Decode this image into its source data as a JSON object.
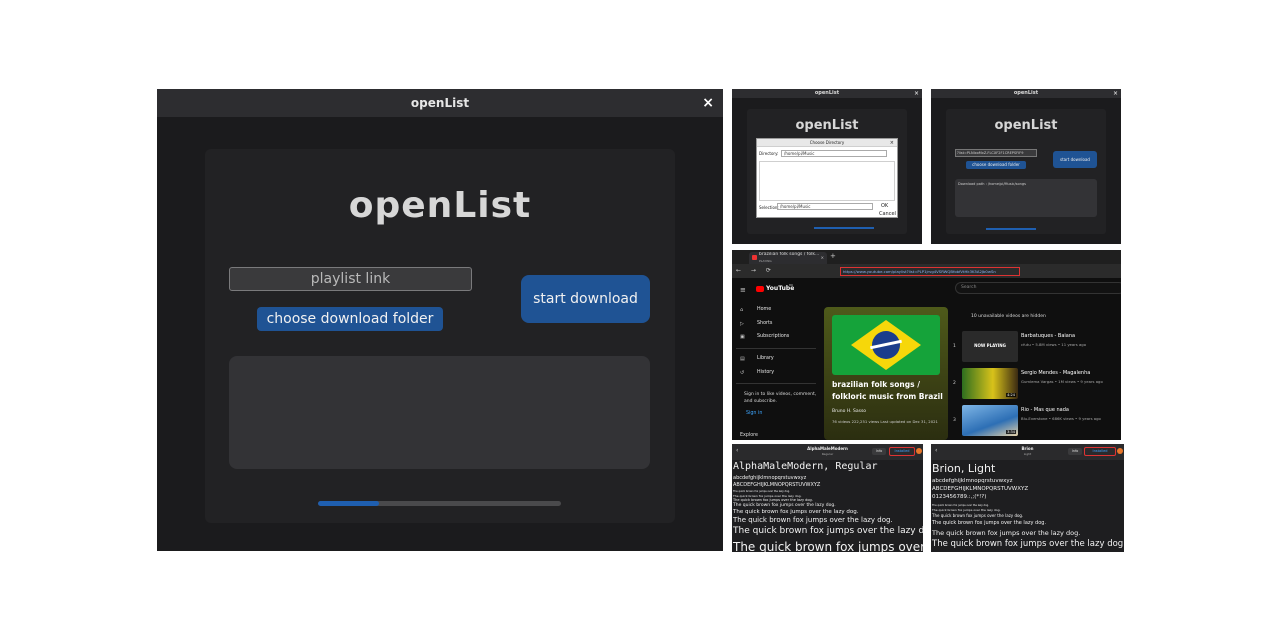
{
  "main": {
    "title": "openList",
    "close_glyph": "×",
    "logo_text": "openList",
    "playlist_placeholder": "playlist link",
    "choose_folder_label": "choose download folder",
    "start_download_label": "start download",
    "progress_fraction": 0.25
  },
  "thumb_dialog": {
    "window_title": "openList",
    "close_glyph": "×",
    "logo_text": "openList",
    "dialog_title": "Choose Directory",
    "dialog_close": "×",
    "directory_label": "Directory:",
    "directory_value": "/home/pi/Music",
    "selection_label": "Selection:",
    "selection_value": "/home/pi/Music",
    "ok_label": "OK",
    "cancel_label": "Cancel"
  },
  "thumb_running": {
    "window_title": "openList",
    "close_glyph": "×",
    "logo_text": "openList",
    "url_value": "?list=PLNIxoMxZ-FLCXF2F1CREPSFIF9",
    "choose_folder_label": "choose download folder",
    "start_download_label": "start download",
    "log_text": "Download path : /home/pi/Music/songs"
  },
  "youtube": {
    "tab_title": "brazilian folk songs / folk...",
    "tab_subtitle": "PLAYING",
    "tab_close": "×",
    "new_tab": "+",
    "nav_icons": "← → ⟳",
    "url": "https://www.youtube.com/playlist?list=PLP1jrvg4VSRWQBfobfVtHk3K5A2Jb0wSn",
    "menu_icon": "≡",
    "logo": "YouTube",
    "logo_sup": "BR",
    "search_placeholder": "Search",
    "sidebar": [
      {
        "icon": "⌂",
        "label": "Home"
      },
      {
        "icon": "▷",
        "label": "Shorts"
      },
      {
        "icon": "▣",
        "label": "Subscriptions"
      },
      {
        "icon": "▤",
        "label": "Library"
      },
      {
        "icon": "↺",
        "label": "History"
      }
    ],
    "signin_text": "Sign in to like videos, comment, and subscribe.",
    "signin_button": "Sign in",
    "explore": "Explore",
    "playlist_title": "brazilian folk songs / folkloric music from Brazil",
    "playlist_author": "Bruno H. Sasso",
    "playlist_meta": "76 videos  222,251 views  Last updated on Dec 31, 2021",
    "unavailable_note": "10 unavailable videos are hidden",
    "videos": [
      {
        "num": "1",
        "title": "Barbatuques - Baiana",
        "meta": "cfutu • 5.8M views • 11 years ago",
        "badge": "NOW PLAYING"
      },
      {
        "num": "2",
        "title": "Sergio Mendes - Magalenha",
        "meta": "Gumlema Vargas • 1M views • 9 years ago",
        "badge": "4:24"
      },
      {
        "num": "3",
        "title": "Rio - Mas que nada",
        "meta": "Blu-Everstone • 686K views • 9 years ago",
        "badge": "3:34"
      }
    ]
  },
  "font_preview_1": {
    "back": "‹",
    "title": "AlphaMaleModern",
    "subtitle": "Regular",
    "info_label": "Info",
    "install_label": "Installed",
    "heading": "AlphaMaleModern, Regular",
    "lower": "abcdefghijklmnopqrstuvwxyz",
    "upper": "ABCDEFGHIJKLMNOPQRSTUVWXYZ",
    "samples": [
      "The quick brown fox jumps over the lazy dog.",
      "The quick brown fox jumps over the lazy dog.",
      "The quick brown fox jumps over the lazy dog.",
      "The quick brown fox jumps over the lazy dog.",
      "The quick brown fox jumps over the lazy dog.",
      "The quick brown fox jumps over the lazy dog.",
      "The quick brown fox jumps over the lazy dog.",
      "The quick brown fox jumps over the lazy dog."
    ]
  },
  "font_preview_2": {
    "back": "‹",
    "title": "Brion",
    "subtitle": "Light",
    "info_label": "Info",
    "install_label": "Installed",
    "heading": "Brion, Light",
    "lower": "abcdefghijklmnopqrstuvwxyz",
    "upper": "ABCDEFGHIJKLMNOPQRSTUVWXYZ",
    "digits": "0123456789.:,;(*!?)",
    "samples": [
      "The quick brown fox jumps over the lazy dog.",
      "The quick brown fox jumps over the lazy dog.",
      "The quick brown fox jumps over the lazy dog.",
      "The quick brown fox jumps over the lazy dog.",
      "The quick brown fox jumps over the lazy dog.",
      "The quick brown fox jumps over the lazy dog."
    ]
  },
  "colors": {
    "window_bg": "#1b1b1d",
    "titlebar_bg": "#2d2d30",
    "panel_bg": "#222224",
    "accent_button": "#1f5394",
    "progress_fill": "#1f5fb0"
  }
}
